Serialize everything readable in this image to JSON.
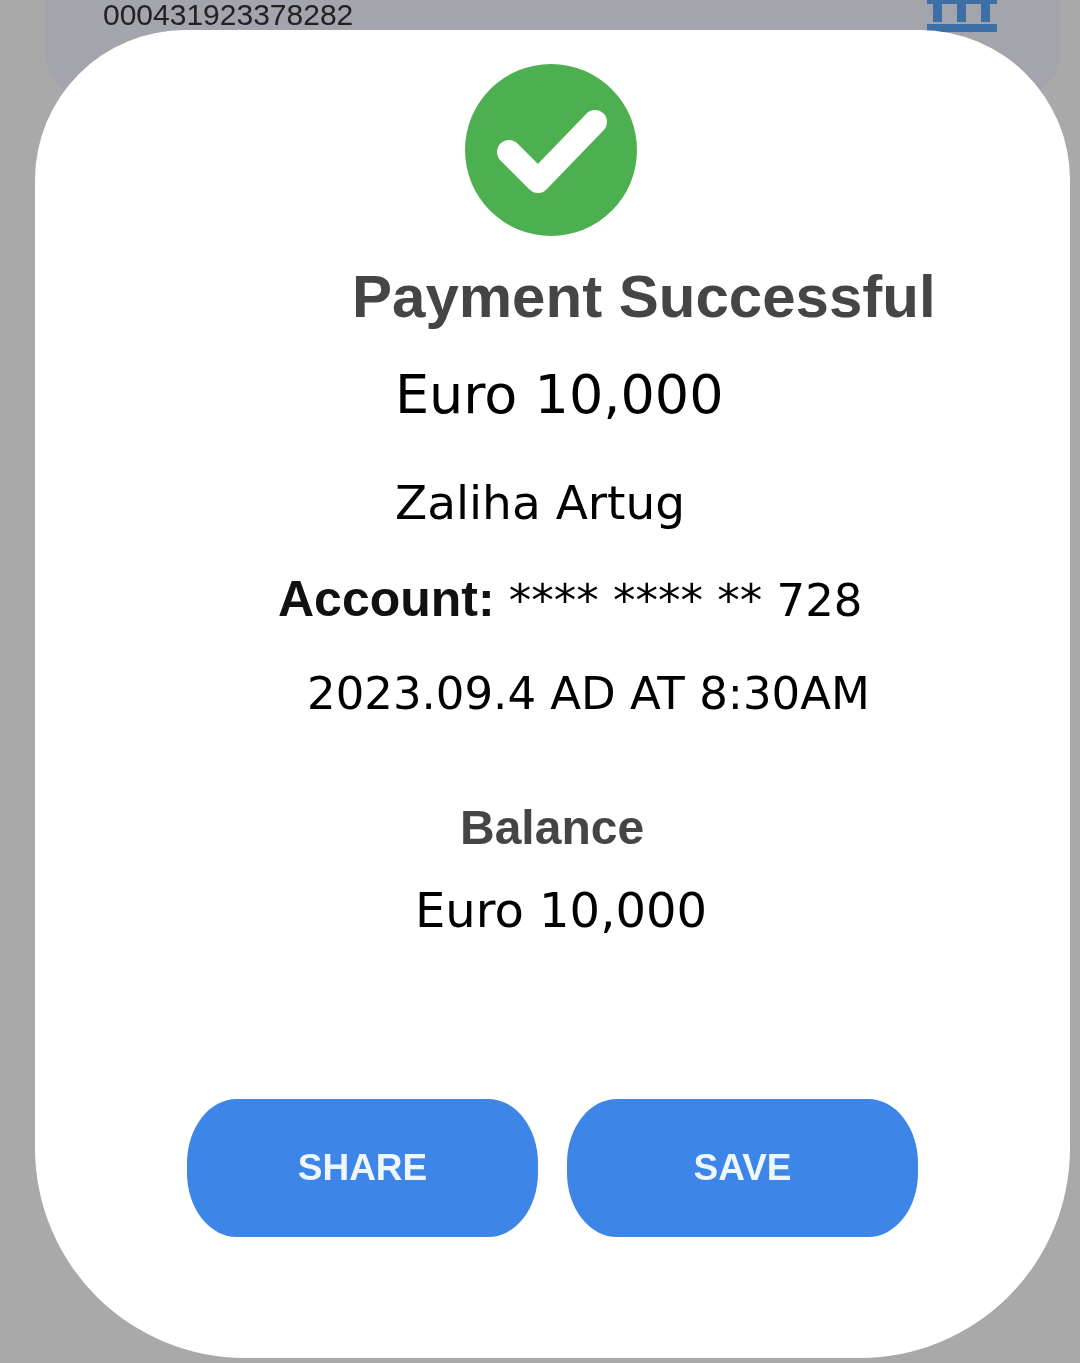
{
  "background_card": {
    "account_number": "000431923378282"
  },
  "dialog": {
    "status": {
      "kind": "success",
      "title": "Payment Successful"
    },
    "amount": "Euro 10,000",
    "recipient": "Zaliha Artug",
    "account": {
      "label": "Account:",
      "value": "**** **** ** 728"
    },
    "datetime": "2023.09.4 AD AT 8:30AM",
    "balance": {
      "label": "Balance",
      "value": "Euro 10,000"
    },
    "buttons": [
      "SHARE",
      "SAVE"
    ]
  }
}
